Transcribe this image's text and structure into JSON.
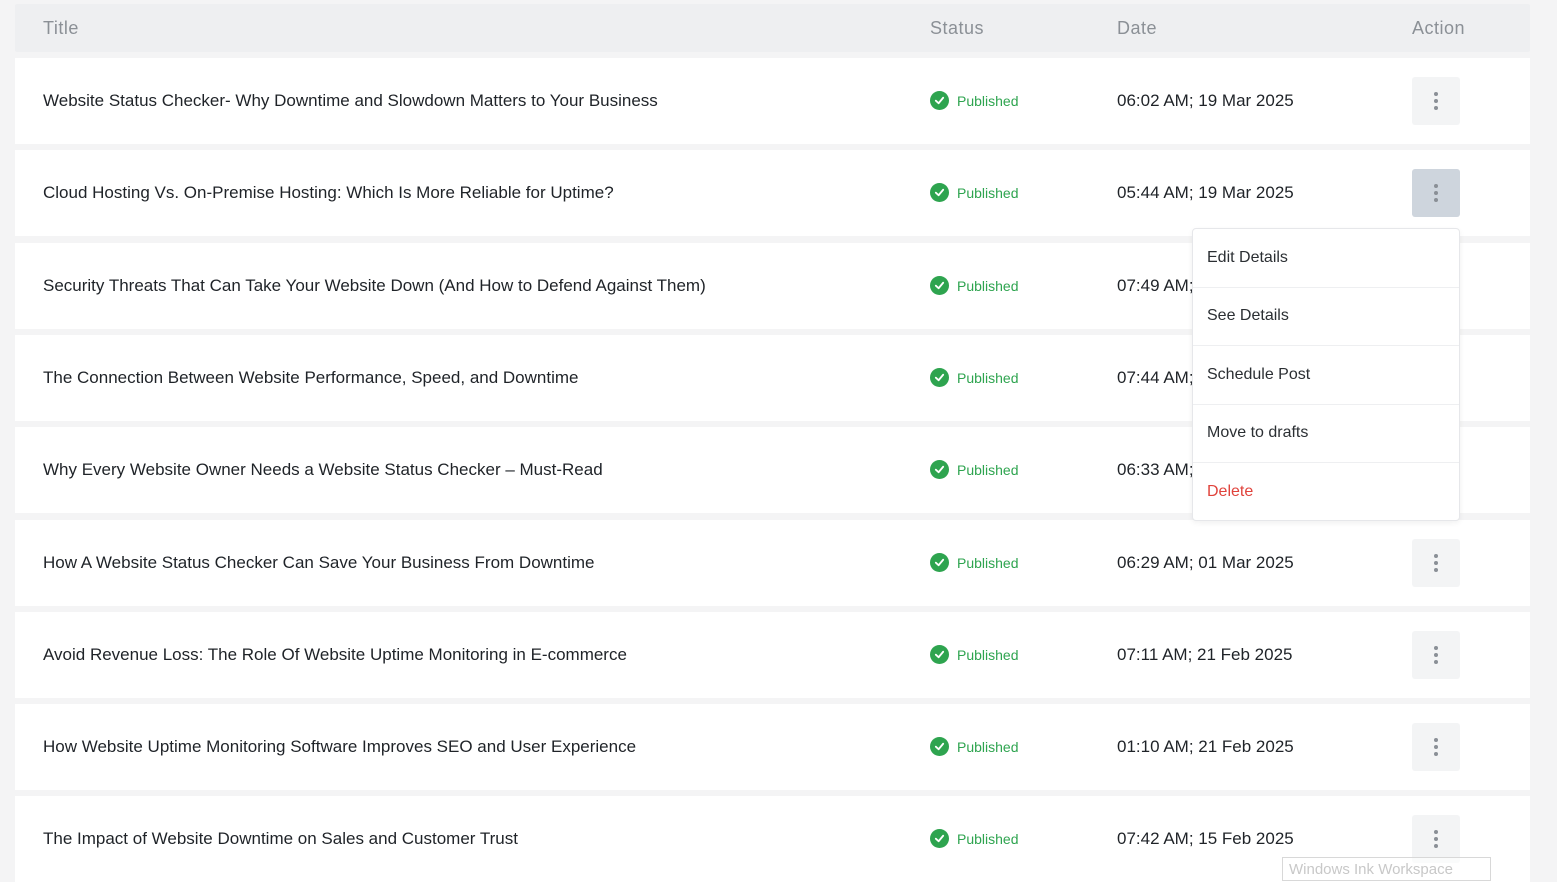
{
  "header": {
    "title": "Title",
    "status": "Status",
    "date": "Date",
    "action": "Action"
  },
  "rows": [
    {
      "title": "Website Status Checker- Why Downtime and Slowdown Matters to Your Business",
      "status": "Published",
      "date": "06:02 AM; 19 Mar 2025"
    },
    {
      "title": "Cloud Hosting Vs. On-Premise Hosting: Which Is More Reliable for Uptime?",
      "status": "Published",
      "date": "05:44 AM; 19 Mar 2025"
    },
    {
      "title": "Security Threats That Can Take Your Website Down (And How to Defend Against Them)",
      "status": "Published",
      "date": "07:49 AM;"
    },
    {
      "title": "The Connection Between Website Performance, Speed, and Downtime",
      "status": "Published",
      "date": "07:44 AM;"
    },
    {
      "title": "Why Every Website Owner Needs a Website Status Checker – Must-Read",
      "status": "Published",
      "date": "06:33 AM;"
    },
    {
      "title": "How A Website Status Checker Can Save Your Business From Downtime",
      "status": "Published",
      "date": "06:29 AM; 01 Mar 2025"
    },
    {
      "title": "Avoid Revenue Loss: The Role Of Website Uptime Monitoring in E-commerce",
      "status": "Published",
      "date": "07:11 AM; 21 Feb 2025"
    },
    {
      "title": "How Website Uptime Monitoring Software Improves SEO and User Experience",
      "status": "Published",
      "date": "01:10 AM; 21 Feb 2025"
    },
    {
      "title": "The Impact of Website Downtime on Sales and Customer Trust",
      "status": "Published",
      "date": "07:42 AM; 15 Feb 2025"
    }
  ],
  "action_menu": {
    "items": [
      "Edit Details",
      "See Details",
      "Schedule Post",
      "Move to drafts",
      "Delete"
    ]
  },
  "icons": {
    "status": "check-circle-icon",
    "action": "more-vertical-icon"
  },
  "colors": {
    "published": "#2ea44f",
    "delete": "#e0433c",
    "active_button": "#ced5dd"
  },
  "watermark": "Windows Ink Workspace"
}
